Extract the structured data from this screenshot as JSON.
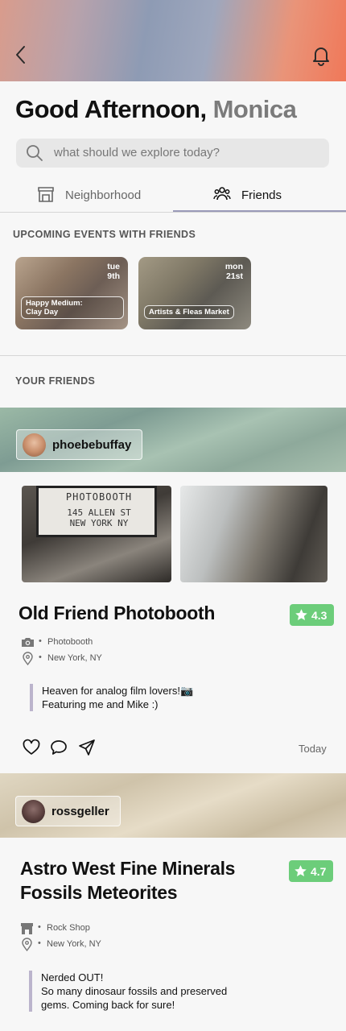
{
  "header": {
    "greeting": "Good Afternoon,",
    "user_name": "Monica"
  },
  "search": {
    "placeholder": "what should we explore today?"
  },
  "tabs": [
    {
      "label": "Neighborhood",
      "active": false,
      "icon": "storefront-icon"
    },
    {
      "label": "Friends",
      "active": true,
      "icon": "people-icon"
    }
  ],
  "events_section": {
    "title": "UPCOMING EVENTS WITH FRIENDS",
    "events": [
      {
        "day": "tue",
        "date": "9th",
        "name_line1": "Happy Medium:",
        "name_line2": "Clay Day"
      },
      {
        "day": "mon",
        "date": "21st",
        "name_line1": "Artists & Fleas Market",
        "name_line2": ""
      }
    ]
  },
  "friends_section": {
    "title": "YOUR FRIENDS"
  },
  "posts": [
    {
      "username": "phoebebuffay",
      "title_line1": "Old Friend Photobooth",
      "title_line2": "",
      "rating": "4.3",
      "category": "Photobooth",
      "category_icon": "camera-icon",
      "location": "New York, NY",
      "quote_line1": "Heaven for analog film lovers!📷",
      "quote_line2": "Featuring me and Mike :)",
      "quote_line3": "",
      "date": "Today",
      "photo_sign_line1": "PHOTOBOOTH",
      "photo_sign_line2": "145 ALLEN ST",
      "photo_sign_line3": "NEW YORK NY"
    },
    {
      "username": "rossgeller",
      "title_line1": "Astro West Fine Minerals",
      "title_line2": "Fossils Meteorites",
      "rating": "4.7",
      "category": "Rock Shop",
      "category_icon": "storefront-icon",
      "location": "New York, NY",
      "quote_line1": "Nerded OUT!",
      "quote_line2": "So many dinosaur fossils and preserved",
      "quote_line3": "gems. Coming back for sure!"
    }
  ],
  "colors": {
    "accent": "#9a9ab8",
    "rating_green": "#6ccd7a",
    "quote_bar": "#bbb4cc"
  }
}
